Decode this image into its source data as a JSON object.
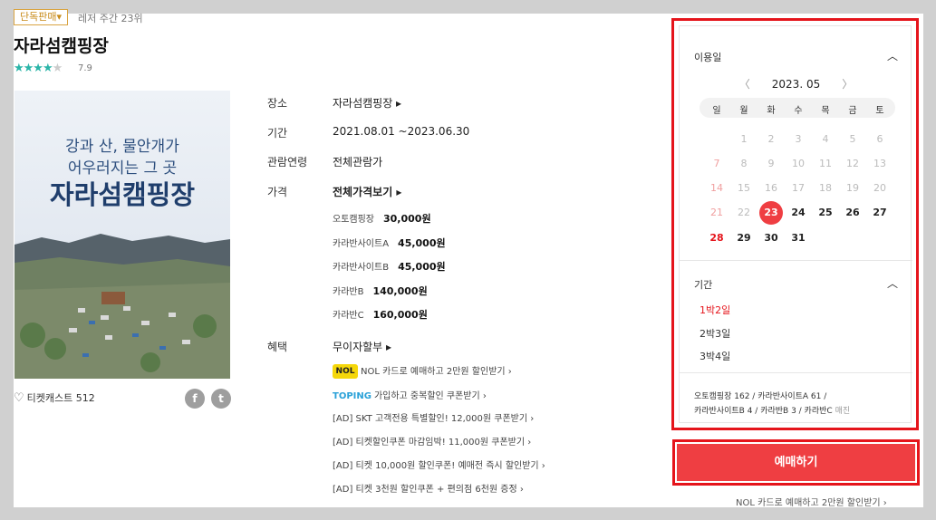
{
  "header": {
    "badge": "단독판매▾",
    "rank": "레저 주간 23위",
    "title": "자라섬캠핑장",
    "stars_on": "★★★★",
    "stars_off": "★",
    "rating": "7.9"
  },
  "poster": {
    "line1": "강과 산, 물안개가",
    "line2": "어우러지는 그 곳",
    "big": "자라섬캠핑장"
  },
  "like": {
    "label": "티켓캐스트",
    "count": "512"
  },
  "social": {
    "facebook": "f",
    "twitter": "t"
  },
  "info": {
    "place_label": "장소",
    "place_value": "자라섬캠핑장 ▸",
    "period_label": "기간",
    "period_value": "2021.08.01 ~2023.06.30",
    "age_label": "관람연령",
    "age_value": "전체관람가",
    "price_label": "가격",
    "price_value": "전체가격보기 ▸",
    "prices": [
      {
        "name": "오토캠핑장",
        "price": "30,000원"
      },
      {
        "name": "카라반사이트A",
        "price": "45,000원"
      },
      {
        "name": "카라반사이트B",
        "price": "45,000원"
      },
      {
        "name": "카라반B",
        "price": "140,000원"
      },
      {
        "name": "카라반C",
        "price": "160,000원"
      }
    ],
    "benefit_label": "혜택",
    "benefit_value": "무이자할부 ▸",
    "benefits": [
      "NOL 카드로 예매하고 2만원 할인받기 ›",
      "가입하고 중복할인 쿠폰받기 ›",
      "[AD] SKT 고객전용 특별할인! 12,000원 쿠폰받기 ›",
      "[AD] 티켓할인쿠폰 마감임박! 11,000원 쿠폰받기 ›",
      "[AD] 티켓 10,000원 할인쿠폰! 예매전 즉시 할인받기 ›",
      "[AD] 티켓 3천원 할인쿠폰 + 편의점 6천원 증정 ›"
    ],
    "nol_logo": "NOL",
    "toping_logo": "TOPING"
  },
  "calendar": {
    "section_title": "이용일",
    "prev": "〈",
    "next": "〉",
    "month": "2023. 05",
    "weekdays": [
      "일",
      "월",
      "화",
      "수",
      "목",
      "금",
      "토"
    ],
    "weeks": [
      [
        "",
        "1",
        "2",
        "3",
        "4",
        "5",
        "6"
      ],
      [
        "7",
        "8",
        "9",
        "10",
        "11",
        "12",
        "13"
      ],
      [
        "14",
        "15",
        "16",
        "17",
        "18",
        "19",
        "20"
      ],
      [
        "21",
        "22",
        "23",
        "24",
        "25",
        "26",
        "27"
      ],
      [
        "28",
        "29",
        "30",
        "31",
        "",
        "",
        ""
      ]
    ],
    "selected_day": "23"
  },
  "period": {
    "section_title": "기간",
    "options": [
      "1박2일",
      "2박3일",
      "3박4일"
    ],
    "active": "1박2일"
  },
  "remaining": {
    "line1": "오토캠핑장 162 / 카라반사이트A 61 /",
    "line2_a": "카라반사이트B 4 / 카라반B 3 / 카라반C",
    "line2_sold": "매진"
  },
  "actions": {
    "reserve": "예매하기",
    "promo": "NOL 카드로 예매하고 2만원 할인받기 ›"
  },
  "colors": {
    "accent": "#ef3e42",
    "highlight_border": "#e5141b",
    "star": "#2bb5a8"
  }
}
